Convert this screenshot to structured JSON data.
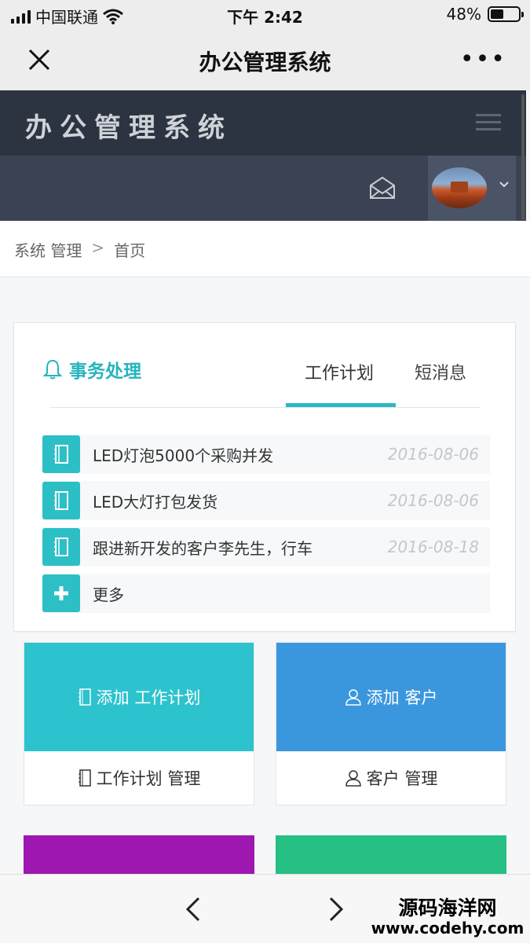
{
  "status_bar": {
    "carrier": "中国联通",
    "time": "下午 2:42",
    "battery": "48%",
    "battery_level": 0.48
  },
  "nav_bar": {
    "title": "办公管理系统",
    "more": "•••"
  },
  "app_header": {
    "logo": "办公管理系统"
  },
  "breadcrumb": {
    "items": [
      "系统 管理",
      "首页"
    ],
    "separator": ">"
  },
  "tasks_panel": {
    "title": "事务处理",
    "tabs": [
      {
        "label": "工作计划",
        "active": true
      },
      {
        "label": "短消息",
        "active": false
      }
    ],
    "items": [
      {
        "text": "LED灯泡5000个采购并发",
        "date": "2016-08-06"
      },
      {
        "text": "LED大灯打包发货",
        "date": "2016-08-06"
      },
      {
        "text": "跟进新开发的客户李先生，行车",
        "date": "2016-08-18"
      }
    ],
    "more_label": "更多"
  },
  "tiles": [
    {
      "top_label": "添加 工作计划",
      "bottom_label": "工作计划 管理",
      "color": "#2cc3ce"
    },
    {
      "top_label": "添加 客户",
      "bottom_label": "客户 管理",
      "color": "#3a97dd"
    }
  ],
  "colors": {
    "accent": "#2ab8c4",
    "header_dark": "#2c3442",
    "tile_purple": "#9d17b0",
    "tile_green": "#27c084"
  },
  "watermark": {
    "line1": "源码海洋网",
    "line2": "www.codehy.com"
  }
}
